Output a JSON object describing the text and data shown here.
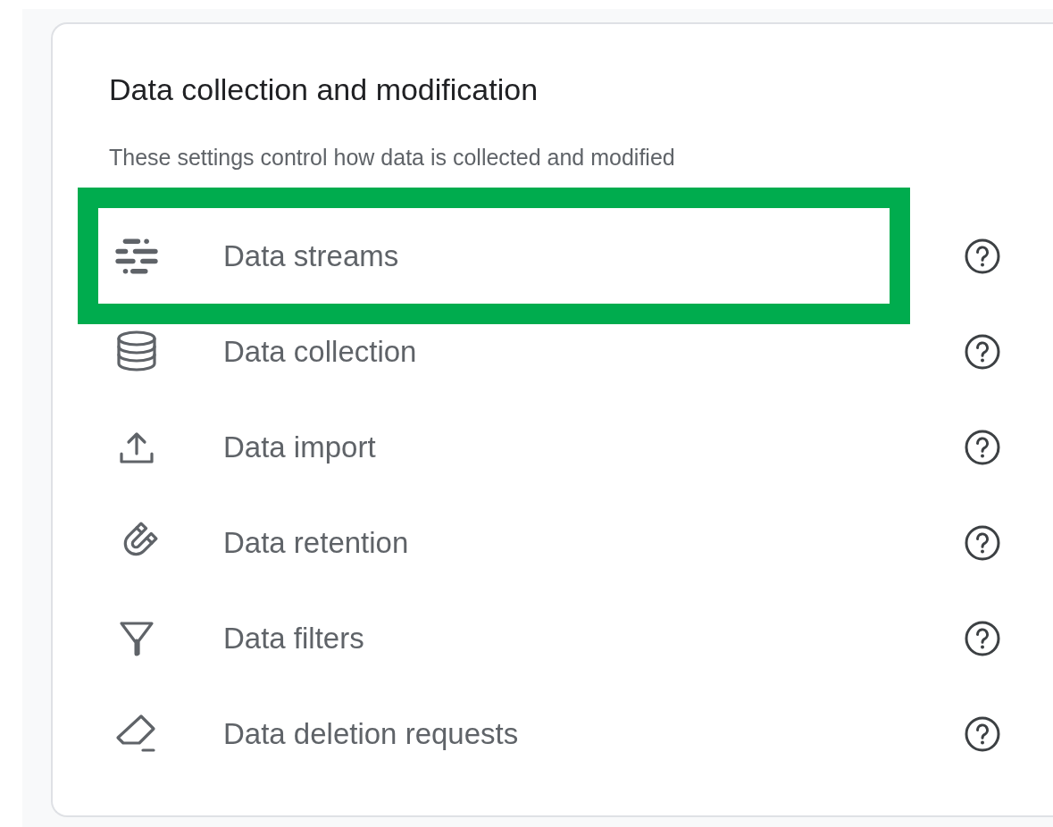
{
  "card": {
    "title": "Data collection and modification",
    "subtitle": "These settings control how data is collected and modified",
    "items": [
      {
        "kind": "streams",
        "label": "Data streams",
        "highlighted": true
      },
      {
        "kind": "database",
        "label": "Data collection",
        "highlighted": false
      },
      {
        "kind": "upload",
        "label": "Data import",
        "highlighted": false
      },
      {
        "kind": "magnet",
        "label": "Data retention",
        "highlighted": false
      },
      {
        "kind": "filter",
        "label": "Data filters",
        "highlighted": false
      },
      {
        "kind": "eraser",
        "label": "Data deletion requests",
        "highlighted": false
      }
    ]
  }
}
